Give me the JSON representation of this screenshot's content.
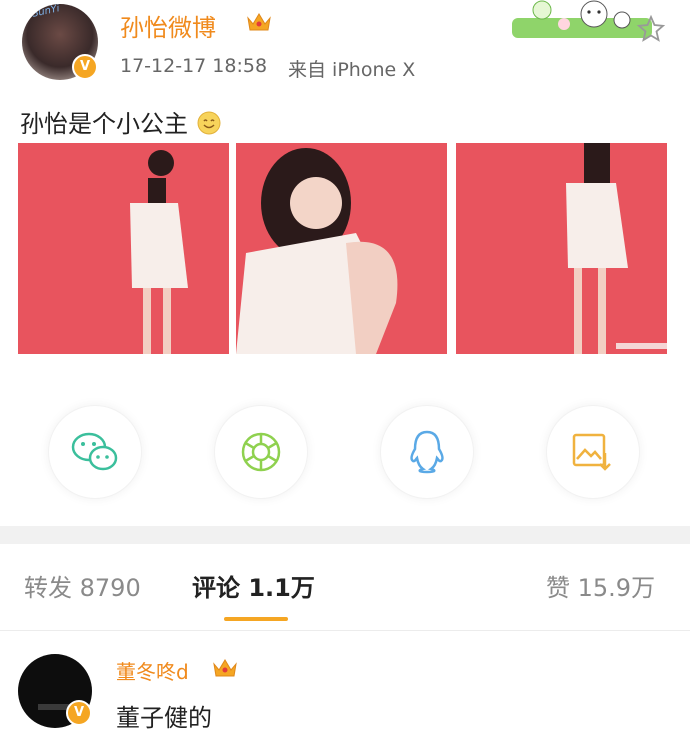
{
  "post": {
    "author": "孙怡微博",
    "time": "17-12-17 18:58",
    "source": "来自 iPhone X",
    "text": "孙怡是个小公主",
    "emoji": "smile-emoji",
    "verified_badge": "V",
    "avatar_caption": "SunYi"
  },
  "share": [
    {
      "icon": "wechat-icon",
      "color": "#3bbf9c"
    },
    {
      "icon": "moments-icon",
      "color": "#8fd14f"
    },
    {
      "icon": "qq-icon",
      "color": "#5aa9e6"
    },
    {
      "icon": "save-image-icon",
      "color": "#f0b23e"
    }
  ],
  "tabs": {
    "repost_label": "转发",
    "repost_count": "8790",
    "comment_label": "评论",
    "comment_count": "1.1万",
    "like_label": "赞",
    "like_count": "15.9万"
  },
  "comment": {
    "author": "董冬咚d",
    "text": "董子健的",
    "verified_badge": "V"
  },
  "colors": {
    "accent": "#f5a623",
    "name": "#f08a1c",
    "photo_bg": "#e8545e"
  }
}
